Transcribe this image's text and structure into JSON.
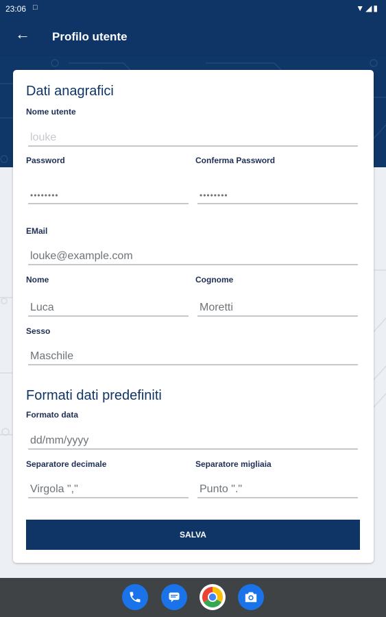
{
  "status_bar": {
    "time": "23:06"
  },
  "app_bar": {
    "title": "Profilo utente"
  },
  "section_personal": {
    "title": "Dati anagrafici",
    "username": {
      "label": "Nome utente",
      "placeholder": "louke"
    },
    "password": {
      "label": "Password",
      "value": "••••••••"
    },
    "confirm_password": {
      "label": "Conferma Password",
      "value": "••••••••"
    },
    "email": {
      "label": "EMail",
      "value": "louke@example.com"
    },
    "first_name": {
      "label": "Nome",
      "value": "Luca"
    },
    "last_name": {
      "label": "Cognome",
      "value": "Moretti"
    },
    "gender": {
      "label": "Sesso",
      "value": "Maschile"
    }
  },
  "section_formats": {
    "title": "Formati dati predefiniti",
    "date_format": {
      "label": "Formato data",
      "value": "dd/mm/yyyy"
    },
    "decimal_separator": {
      "label": "Separatore decimale",
      "value": "Virgola \",\""
    },
    "thousands_separator": {
      "label": "Separatore migliaia",
      "value": "Punto \".\""
    }
  },
  "save_button": {
    "label": "SALVA"
  },
  "dock": {
    "apps": [
      {
        "icon": "phone-icon",
        "color": "#1a73e8"
      },
      {
        "icon": "messages-icon",
        "color": "#1a73e8"
      },
      {
        "icon": "chrome-icon",
        "color": "#ffffff"
      },
      {
        "icon": "camera-icon",
        "color": "#1a73e8"
      }
    ]
  },
  "colors": {
    "primary": "#0e3566",
    "field_underline": "#c5c8cd",
    "label": "#1e2f55"
  }
}
